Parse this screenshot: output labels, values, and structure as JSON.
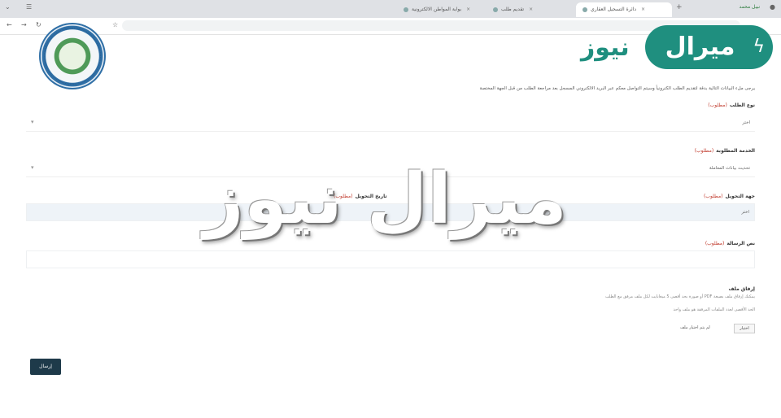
{
  "browser": {
    "tabs": [
      {
        "label": "تقديم طلب",
        "active": false
      },
      {
        "label": "دائرة التسجيل العقاري",
        "active": true
      },
      {
        "label": "بوابة المواطن الالكترونية",
        "active": false
      }
    ],
    "profile_label": "نبيل محمد"
  },
  "form": {
    "instruction": "يرجى ملء البيانات التالية بدقة لتقديم الطلب الكترونياً وسيتم التواصل معكم عبر البريد الالكتروني المسجل بعد مراجعة الطلب من قبل الجهة المختصة",
    "required_mark": "(مطلوب)",
    "request_type": {
      "label": "نوع الطلب",
      "value": "اختر"
    },
    "service": {
      "label": "الخدمة المطلوبة",
      "value": "تحديث بيانات المعاملة"
    },
    "recipient": {
      "label": "جهة التحويل",
      "inline_label": "تاريخ التحويل",
      "value": "اختر"
    },
    "notes": {
      "label": "نص الرسالة",
      "value": ""
    },
    "attachment": {
      "label": "إرفاق ملف",
      "help_1": "يمكنك إرفاق ملف بصيغة PDF أو صورة بحد أقصى 5 ميغابايت لكل ملف مرفق مع الطلب",
      "help_2": "الحد الأقصى لعدد الملفات المرفقة هو ملف واحد",
      "button": "اختيار",
      "status": "لم يتم اختيار ملف"
    },
    "submit_label": "إرسال"
  },
  "logo": {
    "pill_text": "ميرال",
    "word_text": "نيوز",
    "brand_color": "#1f8f7f"
  },
  "watermark": {
    "text": "ميرال نيوز"
  }
}
